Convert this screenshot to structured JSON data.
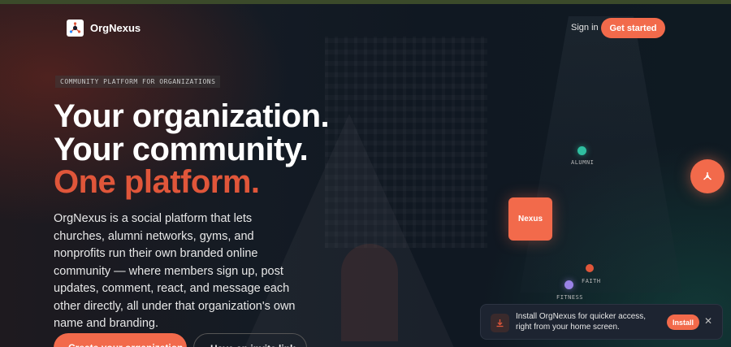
{
  "nav": {
    "brand": "OrgNexus",
    "signin_label": "Sign in",
    "get_started_label": "Get started"
  },
  "hero": {
    "tag": "COMMUNITY PLATFORM FOR ORGANIZATIONS",
    "headline_line1": "Your organization.",
    "headline_line2": "Your community.",
    "headline_line3": "One platform.",
    "description": "OrgNexus is a social platform that lets churches, alumni networks, gyms, and nonprofits run their own branded online community — where members sign up, post updates, comment, react, and message each other directly, all under that organization's own name and branding.",
    "create_button_label": "Create your organization",
    "invite_button_label": "Have an invite link"
  },
  "graph": {
    "nexus_label": "Nexus",
    "nodes": [
      {
        "label": "ALUMNI",
        "color": "#2fbfa0"
      },
      {
        "label": "FAITH",
        "color": "#e0563a"
      },
      {
        "label": "FITNESS",
        "color": "#9a82e6"
      }
    ]
  },
  "install_toast": {
    "message": "Install OrgNexus for quicker access, right from your home screen.",
    "install_label": "Install",
    "close_label": "✕"
  },
  "colors": {
    "accent": "#f26a4b",
    "accent_text": "#e0563a"
  }
}
